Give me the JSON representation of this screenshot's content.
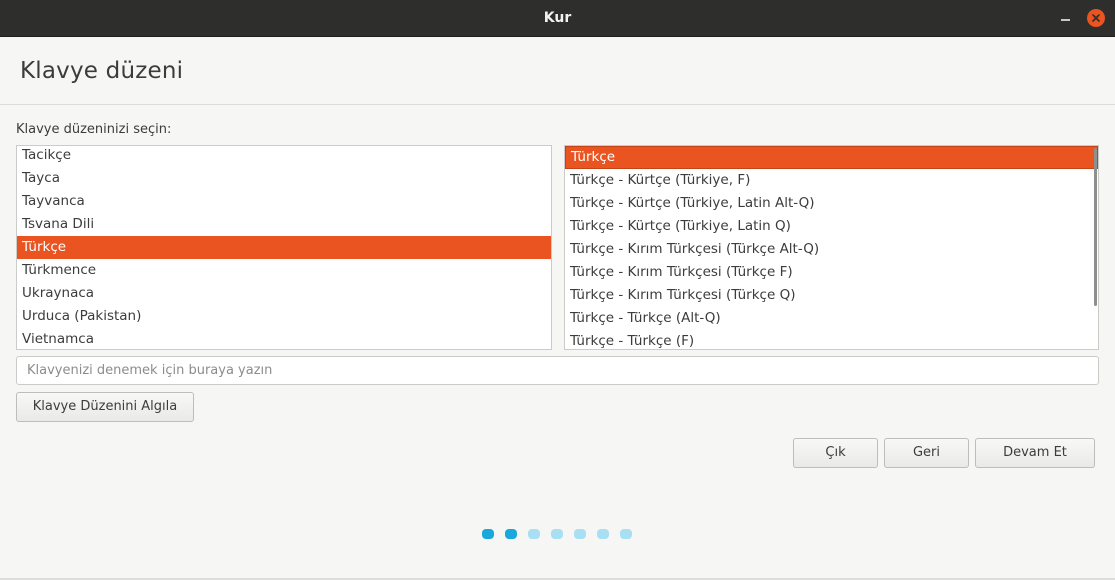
{
  "window": {
    "title": "Kur"
  },
  "page": {
    "title": "Klavye düzeni",
    "section_label": "Klavye düzeninizi seçin:"
  },
  "layouts": {
    "items": [
      "Tacikçe",
      "Tayca",
      "Tayvanca",
      "Tsvana Dili",
      "Türkçe",
      "Türkmence",
      "Ukraynaca",
      "Urduca (Pakistan)",
      "Vietnamca"
    ],
    "selected": "Türkçe"
  },
  "variants": {
    "items": [
      "Türkçe",
      "Türkçe - Kürtçe (Türkiye, F)",
      "Türkçe - Kürtçe (Türkiye, Latin Alt-Q)",
      "Türkçe - Kürtçe (Türkiye, Latin Q)",
      "Türkçe - Kırım Türkçesi (Türkçe Alt-Q)",
      "Türkçe - Kırım Türkçesi (Türkçe F)",
      "Türkçe - Kırım Türkçesi (Türkçe Q)",
      "Türkçe - Türkçe (Alt-Q)",
      "Türkçe - Türkçe (F)"
    ],
    "selected": "Türkçe"
  },
  "test_field": {
    "placeholder": "Klavyenizi denemek için buraya yazın",
    "value": ""
  },
  "buttons": {
    "detect": "Klavye Düzenini Algıla",
    "quit": "Çık",
    "back": "Geri",
    "continue": "Devam Et"
  },
  "progress": {
    "total_steps": 7,
    "completed_steps": 2
  },
  "icons": {
    "minimize": "minimize-icon",
    "close": "close-icon"
  },
  "colors": {
    "accent": "#e95420",
    "titlebar": "#2e2e2d",
    "progress_active": "#19a8dc",
    "progress_inactive": "#a9dff2"
  }
}
